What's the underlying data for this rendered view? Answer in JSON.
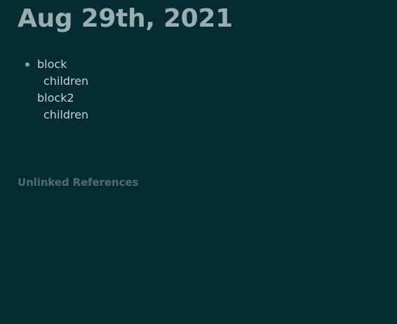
{
  "page": {
    "title": "Aug 29th, 2021"
  },
  "blocks": [
    {
      "text": "block",
      "children": [
        {
          "text": "children"
        }
      ]
    },
    {
      "text": "block2",
      "children": [
        {
          "text": "children"
        }
      ]
    }
  ],
  "references": {
    "unlinked_label": "Unlinked References"
  },
  "colors": {
    "background": "#072b32",
    "title": "#98aeb0",
    "text": "#c3d1d2",
    "muted": "#4d6d72",
    "bullet": "#8aa1a4"
  }
}
